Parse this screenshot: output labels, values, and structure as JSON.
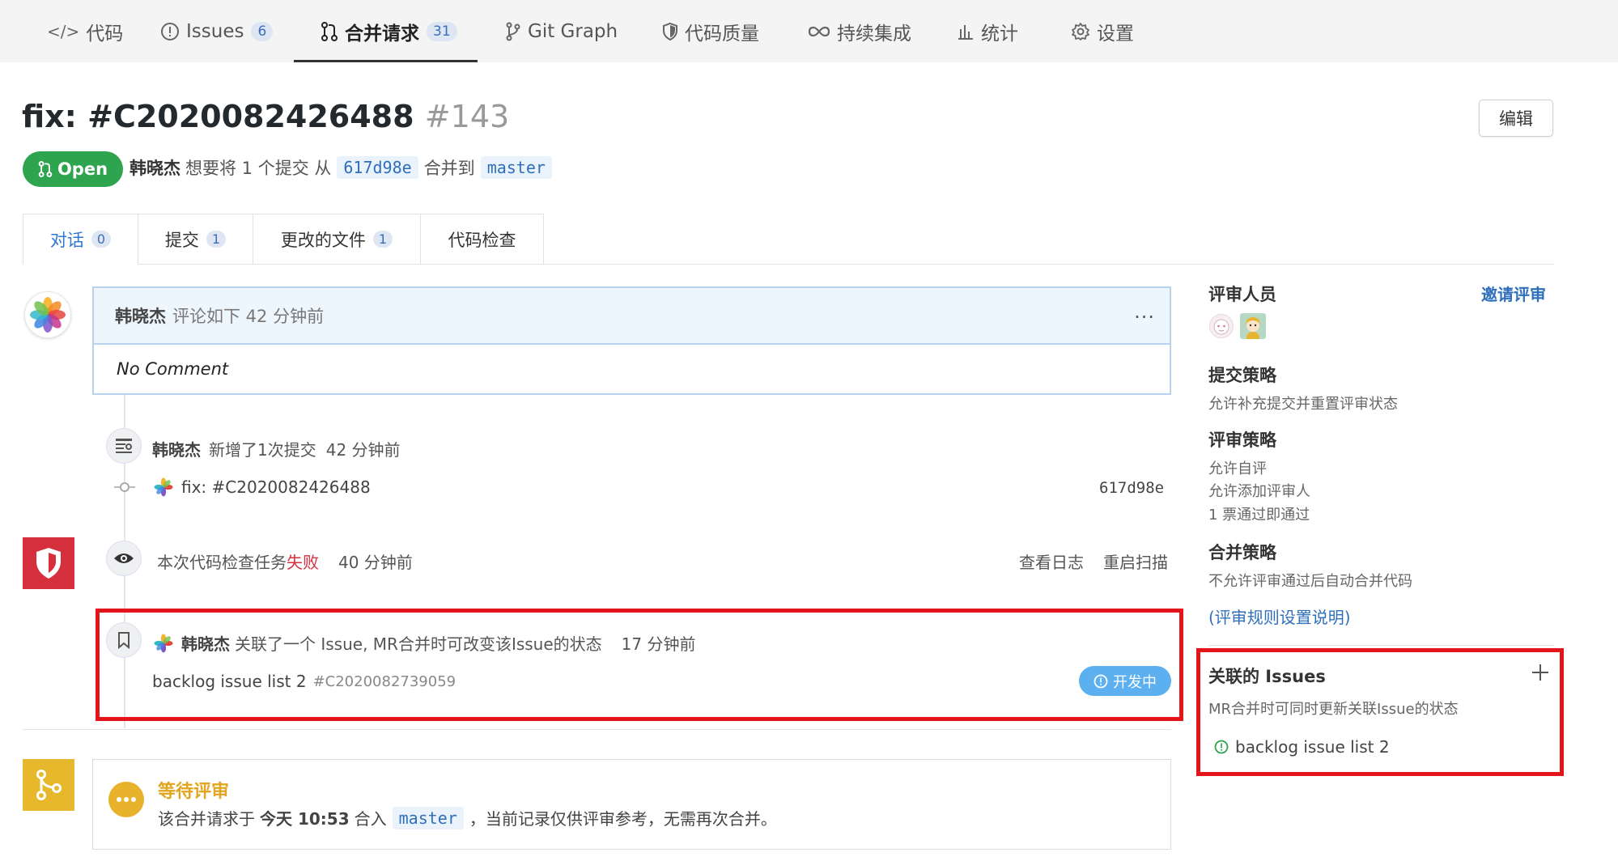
{
  "nav": {
    "code": "代码",
    "issues": "Issues",
    "issues_count": "6",
    "merge_requests": "合并请求",
    "merge_requests_count": "31",
    "git_graph": "Git Graph",
    "code_quality": "代码质量",
    "ci": "持续集成",
    "stats": "统计",
    "settings": "设置"
  },
  "mr": {
    "title": "fix: #C2020082426488",
    "number": "#143",
    "edit_label": "编辑",
    "status": "Open",
    "author": "韩晓杰",
    "summary_part1": "想要将 1 个提交 从",
    "source_commit": "617d98e",
    "summary_part2": "合并到",
    "target_branch": "master"
  },
  "tabs": [
    {
      "label": "对话",
      "count": "0"
    },
    {
      "label": "提交",
      "count": "1"
    },
    {
      "label": "更改的文件",
      "count": "1"
    },
    {
      "label": "代码检查",
      "count": ""
    }
  ],
  "timeline": {
    "comment": {
      "author": "韩晓杰",
      "meta": "评论如下 42 分钟前",
      "more": "···",
      "body": "No Comment"
    },
    "commit_event": {
      "author": "韩晓杰",
      "text": "新增了1次提交",
      "time": "42 分钟前",
      "commit_message": "fix: #C2020082426488",
      "commit_hash": "617d98e"
    },
    "scan_event": {
      "text": "本次代码检查任务",
      "status": "失败",
      "time": "40 分钟前",
      "view_log": "查看日志",
      "restart_scan": "重启扫描"
    },
    "issue_event": {
      "author": "韩晓杰",
      "text": "关联了一个 Issue, MR合并时可改变该Issue的状态",
      "time": "17 分钟前",
      "issue_title": "backlog issue list 2",
      "issue_id": "#C2020082739059",
      "issue_status": "开发中"
    },
    "waiting": {
      "title": "等待评审",
      "desc_part1": "该合并请求于",
      "time": "今天 10:53",
      "desc_part2": "合入",
      "branch": "master",
      "desc_part3": "，当前记录仅供评审参考，无需再次合并。"
    }
  },
  "sidebar": {
    "reviewers_title": "评审人员",
    "invite_review": "邀请评审",
    "commit_policy_title": "提交策略",
    "commit_policy_text": "允许补充提交并重置评审状态",
    "review_policy_title": "评审策略",
    "review_policy_items": [
      "允许自评",
      "允许添加评审人",
      "1 票通过即通过"
    ],
    "merge_policy_title": "合并策略",
    "merge_policy_text": "不允许评审通过后自动合并代码",
    "rules_link": "(评审规则设置说明)",
    "linked_issues_title": "关联的 Issues",
    "linked_issues_desc": "MR合并时可同时更新关联Issue的状态",
    "linked_issue_item": "backlog issue list 2"
  },
  "colors": {
    "open_green": "#2ea44f",
    "link_blue": "#2f6fba",
    "fail_red": "#d62f3d",
    "waiting_yellow": "#e8b22c",
    "highlight_red": "#e4141b"
  }
}
